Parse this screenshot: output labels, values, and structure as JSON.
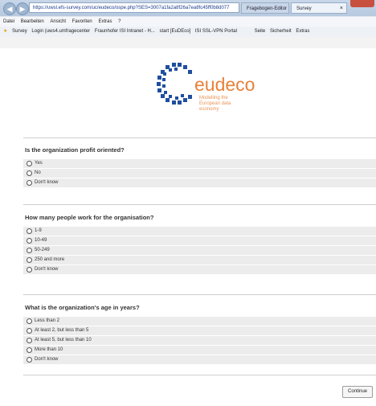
{
  "browser": {
    "address": "https://uwsl.efs-survey.com/uc/eudeco/ospe.php?SES=3007a1fa2a8f26a7ea8fc45ff0b8d077",
    "tabs": [
      {
        "label": "Fragebogen-Editor"
      },
      {
        "label": "Survey"
      }
    ],
    "menu": [
      "Datei",
      "Bearbeiten",
      "Ansicht",
      "Favoriten",
      "Extras",
      "?"
    ],
    "favorites": [
      "Survey",
      "Login (uws4.umfragecenter",
      "Fraunhofer ISI Intranet - H...",
      "start [EuDEco]",
      "ISI SSL-VPN Portal"
    ],
    "toolbar": [
      "Seite",
      "Sicherheit",
      "Extras"
    ]
  },
  "logo": {
    "word": "eudeco",
    "tagline": "Modelling the European data economy"
  },
  "questions": [
    {
      "title": "Is the organization profit oriented?",
      "options": [
        "Yes",
        "No",
        "Don't know"
      ]
    },
    {
      "title": "How many people work for the organisation?",
      "options": [
        "1-9",
        "10-49",
        "50-249",
        "250 and more",
        "Don't know"
      ]
    },
    {
      "title": "What is the organization's age in years?",
      "options": [
        "Less than 2",
        "At least 2, but less than 5",
        "At least 5, but less than 10",
        "More than 10",
        "Don't know"
      ]
    }
  ],
  "continue_label": "Continue",
  "colors": {
    "brand_orange": "#e8813b",
    "brand_blue": "#1f4f9e"
  }
}
